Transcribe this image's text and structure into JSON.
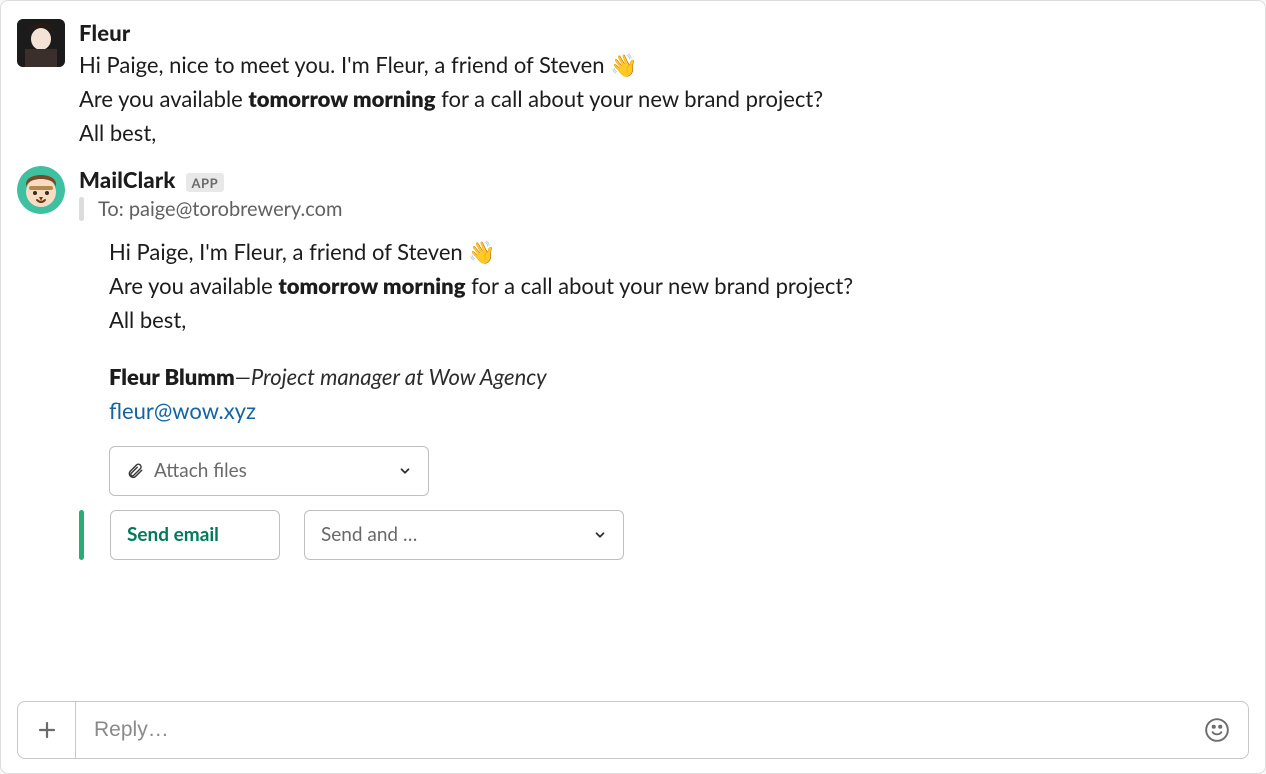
{
  "fleur_message": {
    "sender": "Fleur",
    "line1_prefix": "Hi Paige, nice to meet you. I'm Fleur, a friend of Steven ",
    "line2_prefix": "Are you available ",
    "line2_bold": "tomorrow morning",
    "line2_suffix": " for a call about your new brand project?",
    "line3": "All best,"
  },
  "mailclark_message": {
    "sender": "MailClark",
    "badge": "APP",
    "to_line": "To: paige@torobrewery.com",
    "line1_prefix": "Hi Paige, I'm Fleur, a friend of Steven ",
    "line2_prefix": "Are you available ",
    "line2_bold": "tomorrow morning",
    "line2_suffix": " for a call about your new brand project?",
    "line3": "All best,",
    "sig_name": "Fleur Blumm",
    "sig_dash": "—",
    "sig_title": "Project manager at Wow Agency",
    "sig_email": "fleur@wow.xyz"
  },
  "buttons": {
    "attach": "Attach files",
    "send_email": "Send email",
    "send_and": "Send and …"
  },
  "reply": {
    "placeholder": "Reply…"
  }
}
